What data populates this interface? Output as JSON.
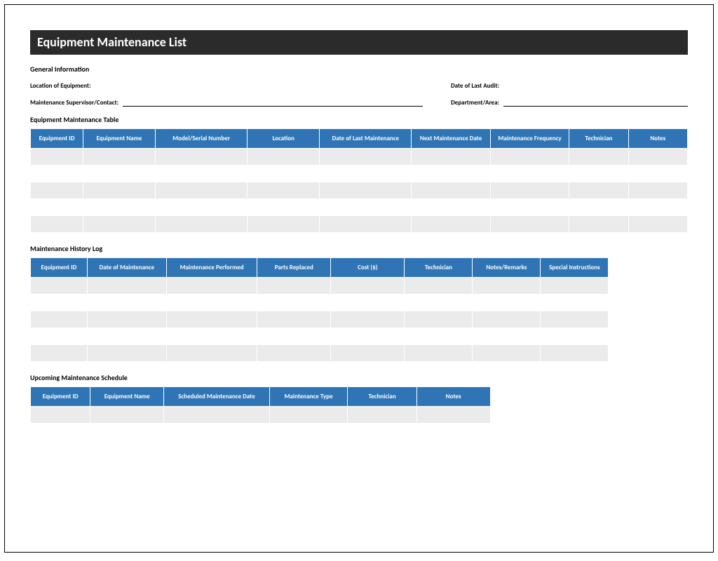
{
  "title": "Equipment Maintenance List",
  "sections": {
    "general": "General Information",
    "table1": "Equipment Maintenance Table",
    "table2": "Maintenance History Log",
    "table3": "Upcoming Maintenance Schedule"
  },
  "info": {
    "location_label": "Location of Equipment:",
    "supervisor_label": "Maintenance Supervisor/Contact:",
    "audit_label": "Date of Last Audit:",
    "dept_label": "Department/Area:"
  },
  "table1_headers": [
    "Equipment ID",
    "Equipment Name",
    "Model/Serial Number",
    "Location",
    "Date of Last Maintenance",
    "Next Maintenance Date",
    "Maintenance Frequency",
    "Technician",
    "Notes"
  ],
  "table2_headers": [
    "Equipment ID",
    "Date of Maintenance",
    "Maintenance Performed",
    "Parts Replaced",
    "Cost ($)",
    "Technician",
    "Notes/Remarks",
    "Special Instructions"
  ],
  "table3_headers": [
    "Equipment ID",
    "Equipment Name",
    "Scheduled Maintenance Date",
    "Maintenance Type",
    "Technician",
    "Notes"
  ],
  "colors": {
    "header_blue": "#2f75b5",
    "title_dark": "#2b2b2b"
  }
}
